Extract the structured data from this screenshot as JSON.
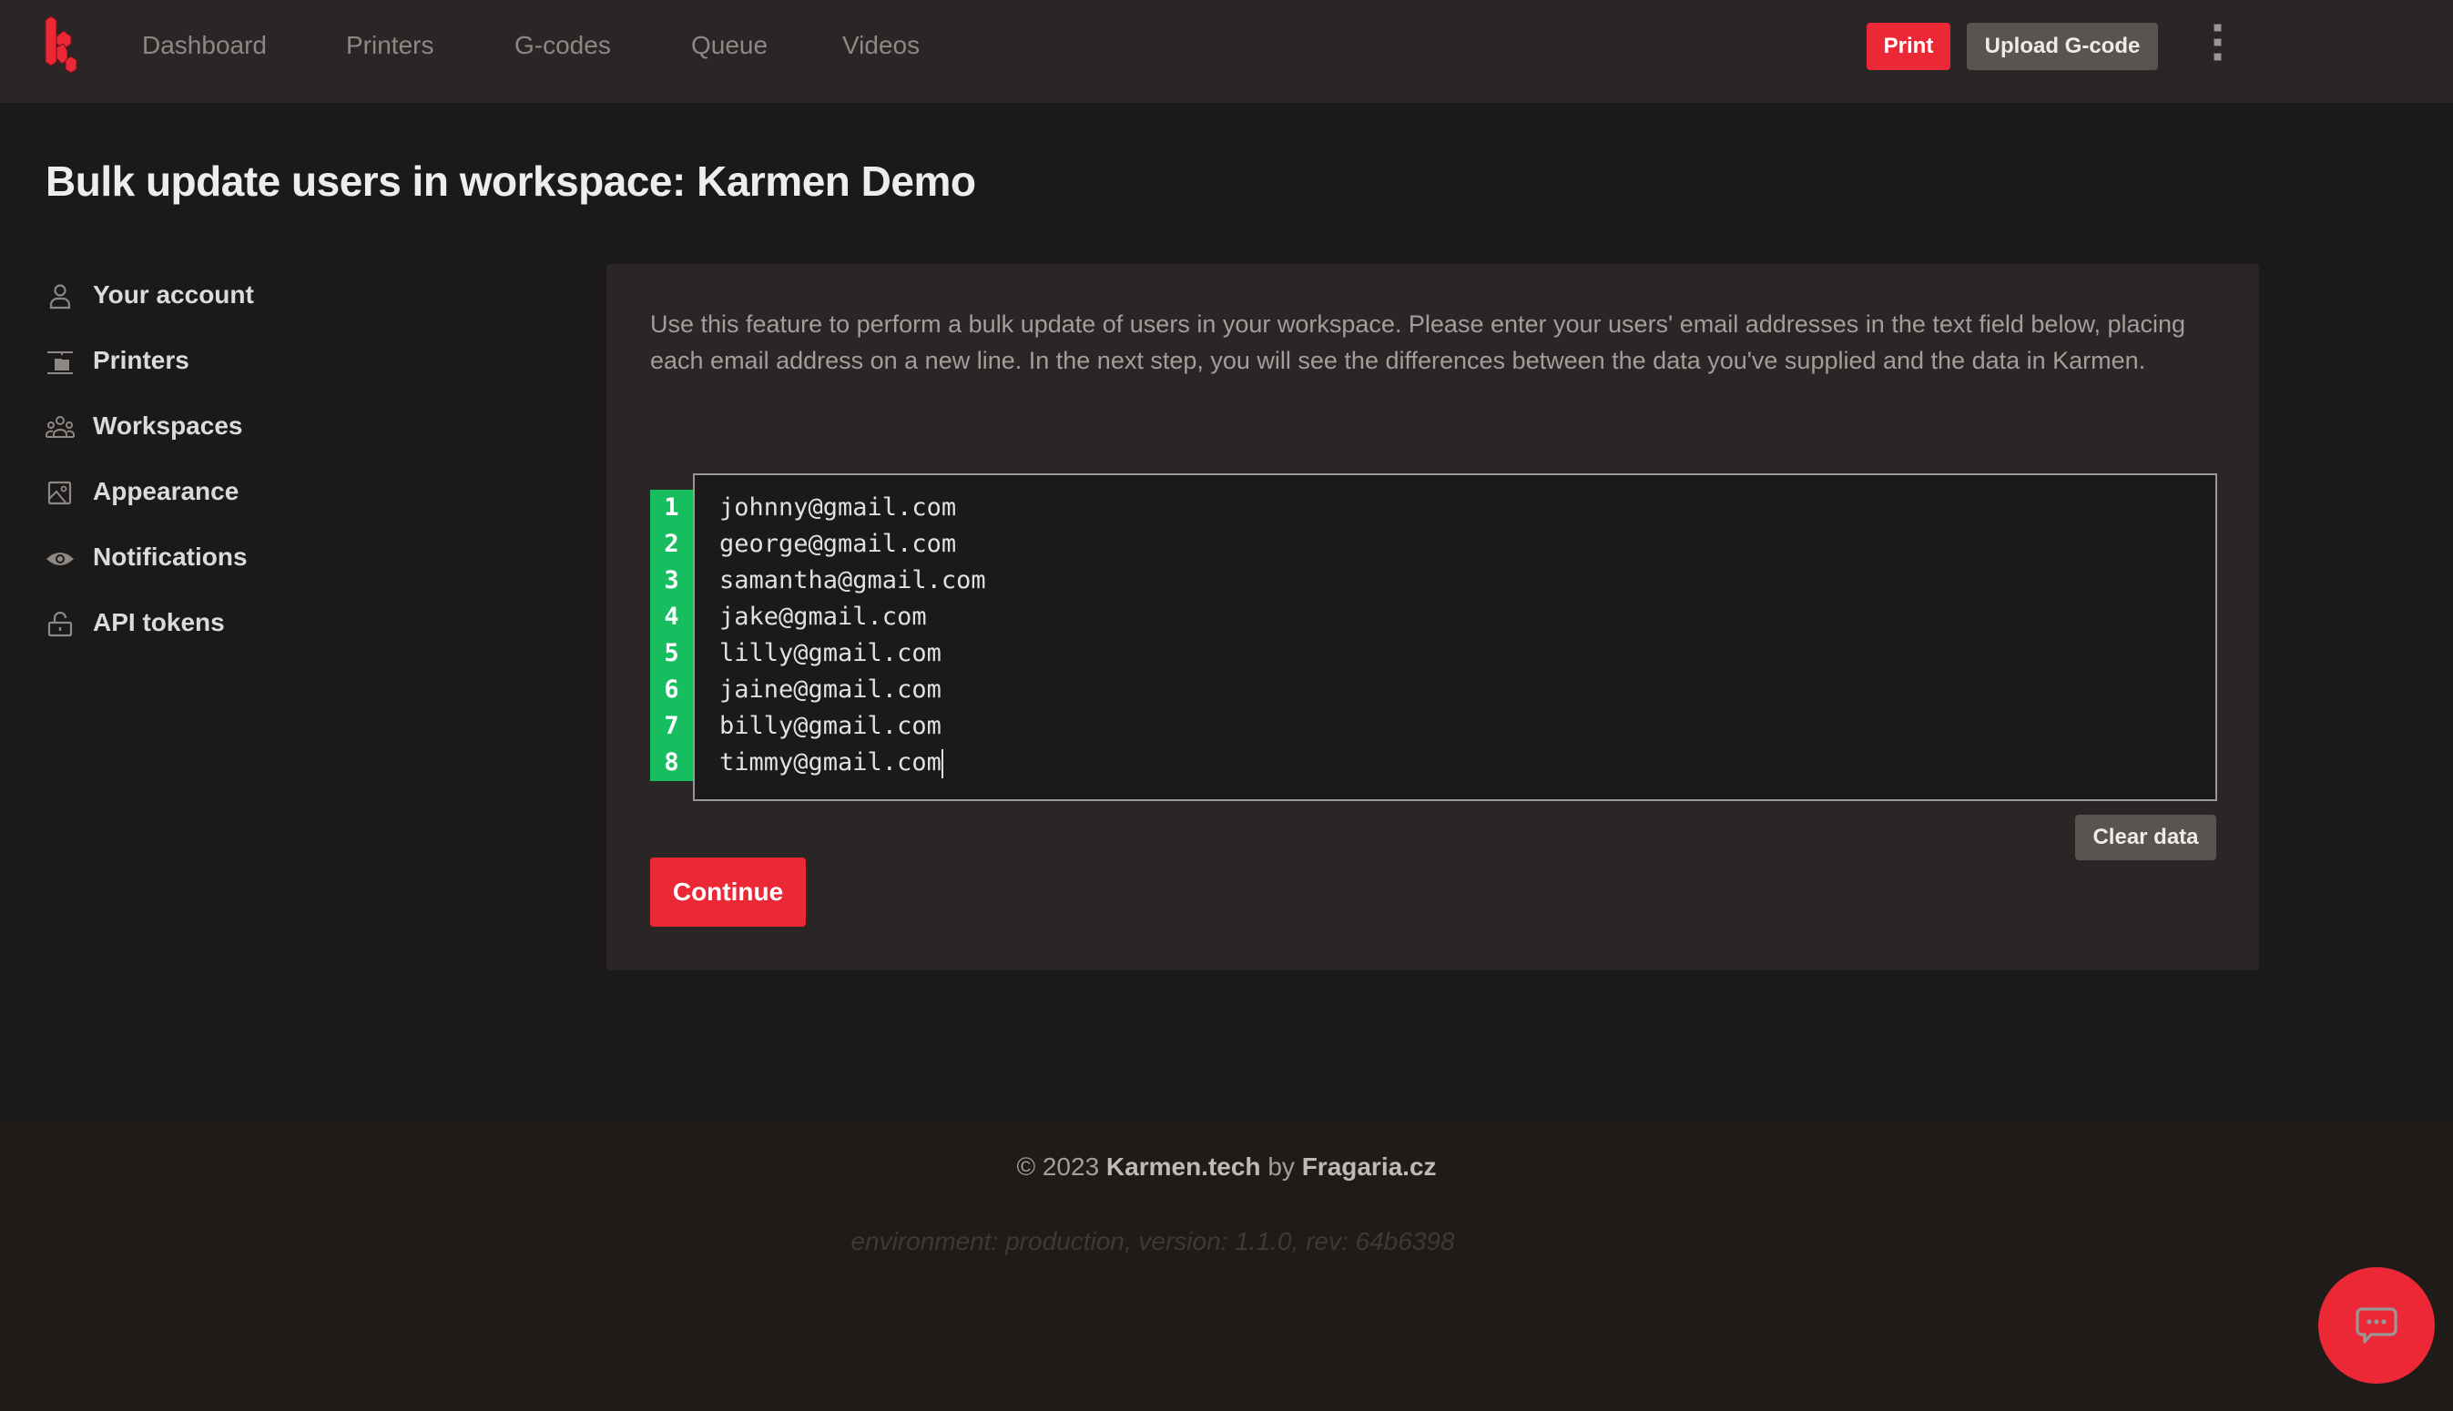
{
  "header": {
    "logo": "karmen-logo-icon",
    "nav": [
      {
        "label": "Dashboard"
      },
      {
        "label": "Printers"
      },
      {
        "label": "G-codes"
      },
      {
        "label": "Queue"
      },
      {
        "label": "Videos"
      }
    ],
    "print_label": "Print",
    "upload_label": "Upload G-code",
    "menu_icon": "kebab-menu-icon"
  },
  "page": {
    "title": "Bulk update users in workspace: Karmen Demo"
  },
  "sidebar": {
    "items": [
      {
        "label": "Your account",
        "icon": "user-icon"
      },
      {
        "label": "Printers",
        "icon": "printer-icon"
      },
      {
        "label": "Workspaces",
        "icon": "users-group-icon"
      },
      {
        "label": "Appearance",
        "icon": "image-icon"
      },
      {
        "label": "Notifications",
        "icon": "eye-icon"
      },
      {
        "label": "API tokens",
        "icon": "unlock-icon"
      }
    ]
  },
  "main": {
    "description": "Use this feature to perform a bulk update of users in your workspace. Please enter your users' email addresses in the text field below, placing each email address on a new line. In the next step, you will see the differences between the data you've supplied and the data in Karmen.",
    "editor": {
      "line_numbers": [
        "1",
        "2",
        "3",
        "4",
        "5",
        "6",
        "7",
        "8"
      ],
      "lines": [
        "johnny@gmail.com",
        "george@gmail.com",
        "samantha@gmail.com",
        "jake@gmail.com",
        "lilly@gmail.com",
        "jaine@gmail.com",
        "billy@gmail.com",
        "timmy@gmail.com"
      ]
    },
    "clear_label": "Clear data",
    "continue_label": "Continue"
  },
  "footer": {
    "copyright_prefix": "© 2023",
    "brand_link": "Karmen.tech",
    "by_text": "by",
    "company_link": "Fragaria.cz",
    "env_text": "environment: production, version: 1.1.0, rev: 64b6398"
  },
  "chat": {
    "icon": "chat-bubble-icon"
  },
  "colors": {
    "accent_red": "#ec2836",
    "gutter_green": "#17bd5f",
    "background": "#1c1a19",
    "surface": "#292625"
  }
}
